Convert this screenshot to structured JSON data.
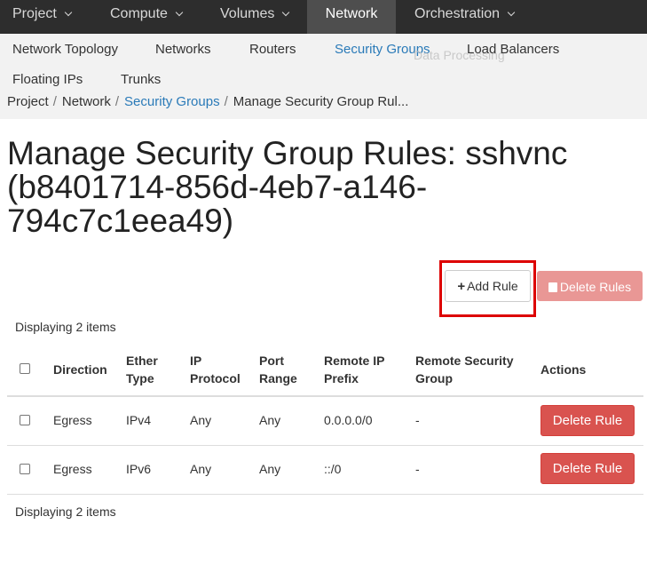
{
  "topnav": {
    "items": [
      {
        "label": "Project"
      },
      {
        "label": "Compute"
      },
      {
        "label": "Volumes"
      },
      {
        "label": "Network"
      },
      {
        "label": "Orchestration"
      }
    ]
  },
  "subnav": {
    "tabs": [
      {
        "label": "Network Topology"
      },
      {
        "label": "Networks"
      },
      {
        "label": "Routers"
      },
      {
        "label": "Security Groups"
      },
      {
        "label": "Load Balancers"
      },
      {
        "label": "Floating IPs"
      },
      {
        "label": "Trunks"
      }
    ],
    "overlay": "Data Processing"
  },
  "breadcrumb": {
    "items": [
      "Project",
      "Network",
      "Security Groups",
      "Manage Security Group Rul..."
    ],
    "separator": "/"
  },
  "page": {
    "title": "Manage Security Group Rules: sshvnc (b8401714-856d-4eb7-a146-794c7c1eea49)"
  },
  "actions": {
    "add_rule": "Add Rule",
    "delete_rules": "Delete Rules"
  },
  "table": {
    "count_top": "Displaying 2 items",
    "count_bottom": "Displaying 2 items",
    "headers": {
      "direction": "Direction",
      "ether_type": "Ether Type",
      "ip_protocol": "IP Protocol",
      "port_range": "Port Range",
      "remote_ip_prefix": "Remote IP Prefix",
      "remote_security_group": "Remote Security Group",
      "actions": "Actions"
    },
    "rows": [
      {
        "direction": "Egress",
        "ether_type": "IPv4",
        "ip_protocol": "Any",
        "port_range": "Any",
        "remote_ip_prefix": "0.0.0.0/0",
        "remote_security_group": "-",
        "action": "Delete Rule"
      },
      {
        "direction": "Egress",
        "ether_type": "IPv6",
        "ip_protocol": "Any",
        "port_range": "Any",
        "remote_ip_prefix": "::/0",
        "remote_security_group": "-",
        "action": "Delete Rule"
      }
    ]
  },
  "colors": {
    "topnav_bg": "#2d2d2d",
    "topnav_active_bg": "#4e4e4e",
    "link": "#2a7ab8",
    "danger": "#d9534f",
    "danger_disabled": "#e99795",
    "highlight": "#dd0000"
  },
  "icons": {
    "caret": "chevron-down-icon",
    "add": "plus-icon",
    "delete": "trash-icon"
  }
}
